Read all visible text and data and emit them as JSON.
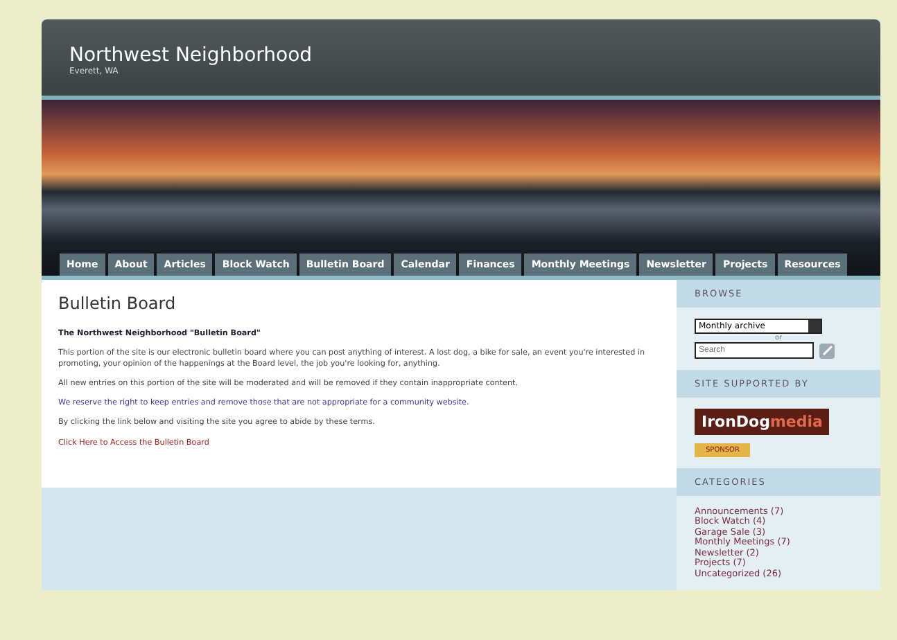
{
  "header": {
    "title": "Northwest Neighborhood",
    "subtitle": "Everett, WA"
  },
  "nav": [
    "Home",
    "About",
    "Articles",
    "Block Watch",
    "Bulletin Board",
    "Calendar",
    "Finances",
    "Monthly Meetings",
    "Newsletter",
    "Projects",
    "Resources"
  ],
  "main": {
    "heading": "Bulletin Board",
    "intro": "The Northwest Neighborhood \"Bulletin Board\"",
    "paragraphs": [
      {
        "kind": "text",
        "text": "This portion of the site is our electronic bulletin board where you can post anything of interest. A lost dog, a bike for sale, an event you're interested in promoting, your opinion of the happenings at the Board level, the job you're looking for, anything."
      },
      {
        "kind": "text",
        "text": "All new entries on this portion of the site will be moderated and will be removed if they contain inappropriate content."
      },
      {
        "kind": "note",
        "text": "We reserve the right to keep entries and remove those that are not appropriate for a community website."
      },
      {
        "kind": "text",
        "text": "By clicking the link below and visiting the site you agree to abide by these terms."
      },
      {
        "kind": "link",
        "text": "Click Here to Access the Bulletin Board"
      }
    ]
  },
  "sidebar": {
    "browse": {
      "heading": "BROWSE",
      "archive": "Monthly archive",
      "or": "or",
      "search_placeholder": "Search"
    },
    "support": {
      "heading": "SITE SUPPORTED BY",
      "logo_left": "IronDog",
      "logo_right": "media",
      "badge": "SPONSOR"
    },
    "categories": {
      "heading": "CATEGORIES",
      "items": [
        "Announcements (7)",
        "Block Watch (4)",
        "Garage Sale (3)",
        "Monthly Meetings (7)",
        "Newsletter (2)",
        "Projects (7)",
        "Uncategorized (26)"
      ]
    }
  }
}
